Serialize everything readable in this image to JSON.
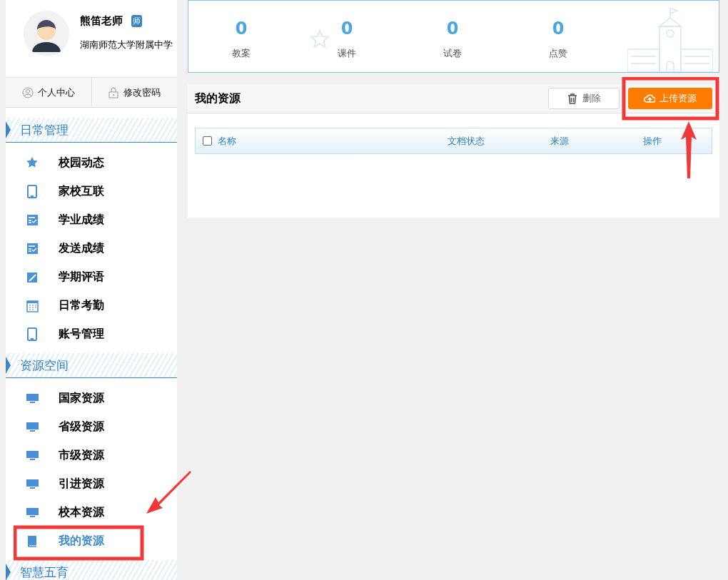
{
  "profile": {
    "name": "熊笛老师",
    "role_badge": "师",
    "school": "湖南师范大学附属中学",
    "links": [
      {
        "kind": "user",
        "label": "个人中心"
      },
      {
        "kind": "lock",
        "label": "修改密码"
      }
    ]
  },
  "sidebar": {
    "sections": [
      {
        "title": "日常管理",
        "items": [
          {
            "kind": "star",
            "label": "校园动态",
            "selected": false
          },
          {
            "kind": "tablet",
            "label": "家校互联",
            "selected": false
          },
          {
            "kind": "score",
            "label": "学业成绩",
            "selected": false
          },
          {
            "kind": "score",
            "label": "发送成绩",
            "selected": false
          },
          {
            "kind": "comment",
            "label": "学期评语",
            "selected": false
          },
          {
            "kind": "calendar",
            "label": "日常考勤",
            "selected": false
          },
          {
            "kind": "tablet",
            "label": "账号管理",
            "selected": false
          }
        ]
      },
      {
        "title": "资源空间",
        "items": [
          {
            "kind": "monitor",
            "label": "国家资源",
            "selected": false
          },
          {
            "kind": "monitor",
            "label": "省级资源",
            "selected": false
          },
          {
            "kind": "monitor",
            "label": "市级资源",
            "selected": false
          },
          {
            "kind": "monitor",
            "label": "引进资源",
            "selected": false
          },
          {
            "kind": "monitor",
            "label": "校本资源",
            "selected": false
          },
          {
            "kind": "book",
            "label": "我的资源",
            "selected": true
          }
        ]
      },
      {
        "title": "智慧五育"
      }
    ]
  },
  "stats": [
    {
      "value": "0",
      "label": "教案"
    },
    {
      "value": "0",
      "label": "课件"
    },
    {
      "value": "0",
      "label": "试卷"
    },
    {
      "value": "0",
      "label": "点赞"
    }
  ],
  "panel": {
    "title": "我的资源",
    "buttons": [
      {
        "kind": "delete",
        "label": "删除"
      },
      {
        "kind": "upload",
        "label": "上传资源"
      }
    ],
    "table": {
      "select_all": {
        "checked": false
      },
      "columns": [
        "名称",
        "文档状态",
        "来源",
        "操作"
      ]
    }
  }
}
